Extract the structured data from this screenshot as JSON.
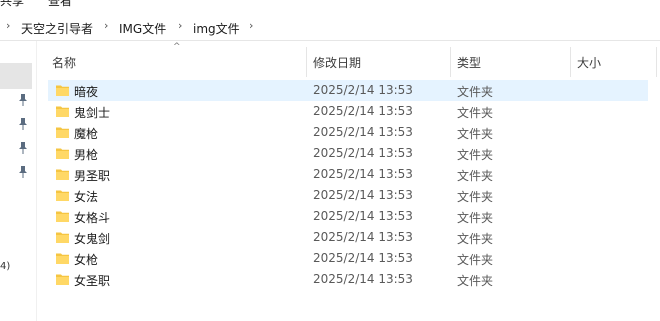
{
  "menu": {
    "items": [
      "共享",
      "查看"
    ]
  },
  "address": {
    "crumbs": [
      "天空之引导者",
      "IMG文件",
      "img文件"
    ],
    "separator": "›"
  },
  "sidebar": {
    "pins": [
      "pin-icon",
      "pin-icon",
      "pin-icon",
      "pin-icon"
    ],
    "partial_text": "4)"
  },
  "columns": {
    "name": "名称",
    "date": "修改日期",
    "type": "类型",
    "size": "大小"
  },
  "files": [
    {
      "name": "暗夜",
      "date": "2025/2/14 13:53",
      "type": "文件夹",
      "size": ""
    },
    {
      "name": "鬼剑士",
      "date": "2025/2/14 13:53",
      "type": "文件夹",
      "size": ""
    },
    {
      "name": "魔枪",
      "date": "2025/2/14 13:53",
      "type": "文件夹",
      "size": ""
    },
    {
      "name": "男枪",
      "date": "2025/2/14 13:53",
      "type": "文件夹",
      "size": ""
    },
    {
      "name": "男圣职",
      "date": "2025/2/14 13:53",
      "type": "文件夹",
      "size": ""
    },
    {
      "name": "女法",
      "date": "2025/2/14 13:53",
      "type": "文件夹",
      "size": ""
    },
    {
      "name": "女格斗",
      "date": "2025/2/14 13:53",
      "type": "文件夹",
      "size": ""
    },
    {
      "name": "女鬼剑",
      "date": "2025/2/14 13:53",
      "type": "文件夹",
      "size": ""
    },
    {
      "name": "女枪",
      "date": "2025/2/14 13:53",
      "type": "文件夹",
      "size": ""
    },
    {
      "name": "女圣职",
      "date": "2025/2/14 13:53",
      "type": "文件夹",
      "size": ""
    }
  ],
  "colors": {
    "selected_row": "#e5f3ff",
    "folder": "#f5c542"
  }
}
